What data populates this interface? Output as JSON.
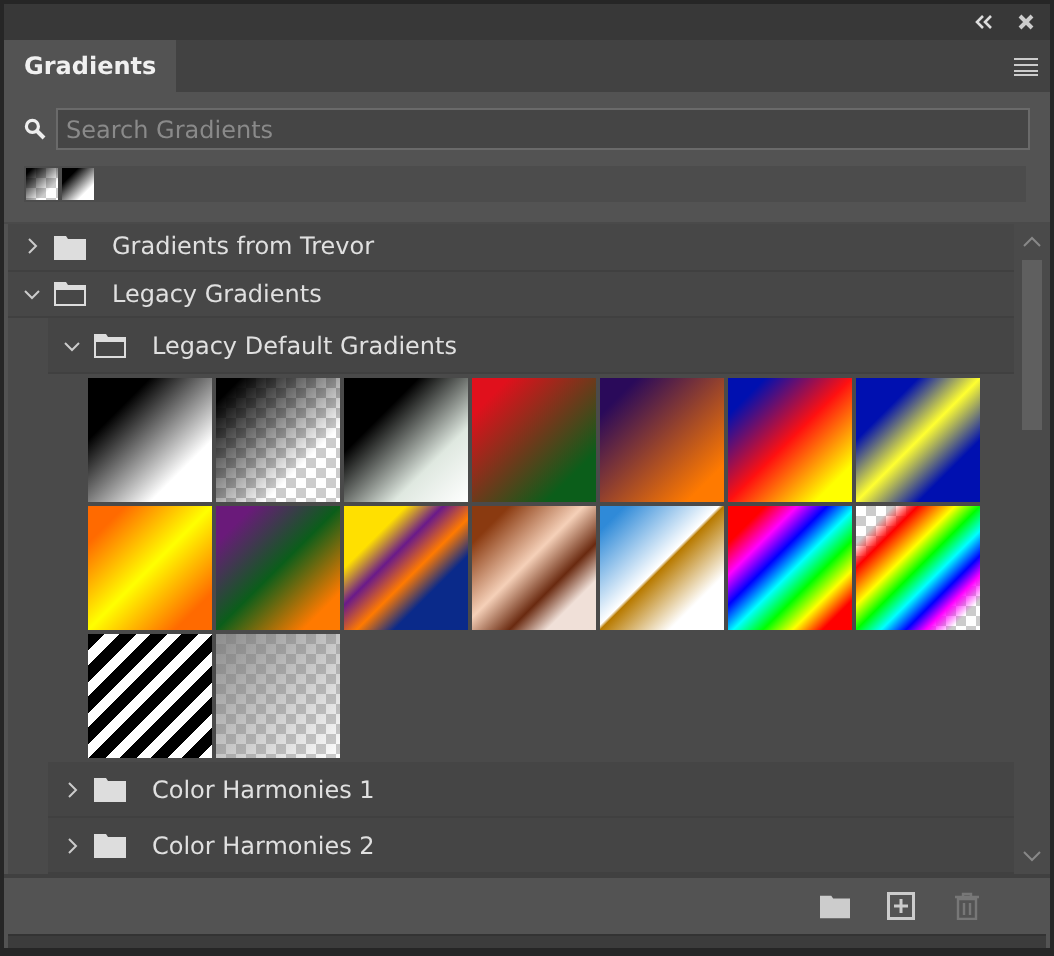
{
  "tab": {
    "label": "Gradients",
    "selected": true
  },
  "search": {
    "placeholder": "Search Gradients"
  },
  "groups": [
    {
      "name": "Gradients from Trevor",
      "expanded": false
    },
    {
      "name": "Legacy Gradients",
      "expanded": true,
      "children": [
        {
          "name": "Legacy Default Gradients",
          "expanded": true
        },
        {
          "name": "Color Harmonies 1",
          "expanded": false
        },
        {
          "name": "Color Harmonies 2",
          "expanded": false
        }
      ]
    }
  ]
}
